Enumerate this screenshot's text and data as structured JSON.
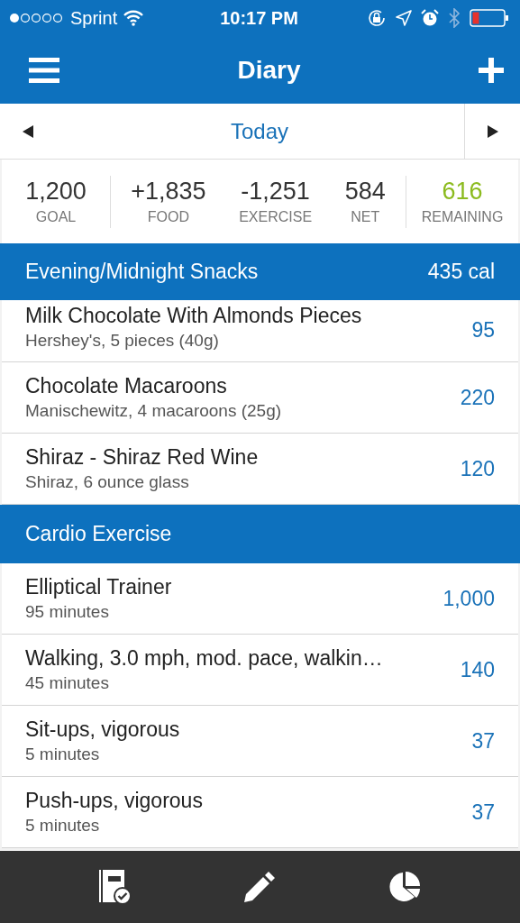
{
  "status_bar": {
    "carrier": "Sprint",
    "time": "10:17 PM"
  },
  "nav": {
    "title": "Diary"
  },
  "date_bar": {
    "label": "Today"
  },
  "summary": {
    "goal": {
      "value": "1,200",
      "label": "GOAL"
    },
    "terms": [
      {
        "value": "+1,835",
        "label": "FOOD"
      },
      {
        "value": "-1,251",
        "label": "EXERCISE"
      },
      {
        "value": "584",
        "label": "NET"
      }
    ],
    "remaining": {
      "value": "616",
      "label": "REMAINING"
    }
  },
  "sections": [
    {
      "title": "Evening/Midnight Snacks",
      "total": "435 cal",
      "entries": [
        {
          "name": "Milk Chocolate With Almonds Pieces",
          "detail": "Hershey's, 5 pieces (40g)",
          "calories": "95"
        },
        {
          "name": "Chocolate Macaroons",
          "detail": "Manischewitz, 4 macaroons (25g)",
          "calories": "220"
        },
        {
          "name": "Shiraz - Shiraz Red Wine",
          "detail": "Shiraz, 6 ounce glass",
          "calories": "120"
        }
      ]
    },
    {
      "title": "Cardio Exercise",
      "entries": [
        {
          "name": "Elliptical Trainer",
          "detail": "95 minutes",
          "calories": "1,000"
        },
        {
          "name": "Walking, 3.0 mph, mod. pace, walkin…",
          "detail": "45 minutes",
          "calories": "140"
        },
        {
          "name": "Sit-ups, vigorous",
          "detail": "5 minutes",
          "calories": "37"
        },
        {
          "name": "Push-ups, vigorous",
          "detail": "5 minutes",
          "calories": "37"
        }
      ]
    }
  ],
  "tab_bar": {
    "tabs": [
      {
        "kind": "diary"
      },
      {
        "kind": "edit"
      },
      {
        "kind": "chart"
      }
    ]
  }
}
